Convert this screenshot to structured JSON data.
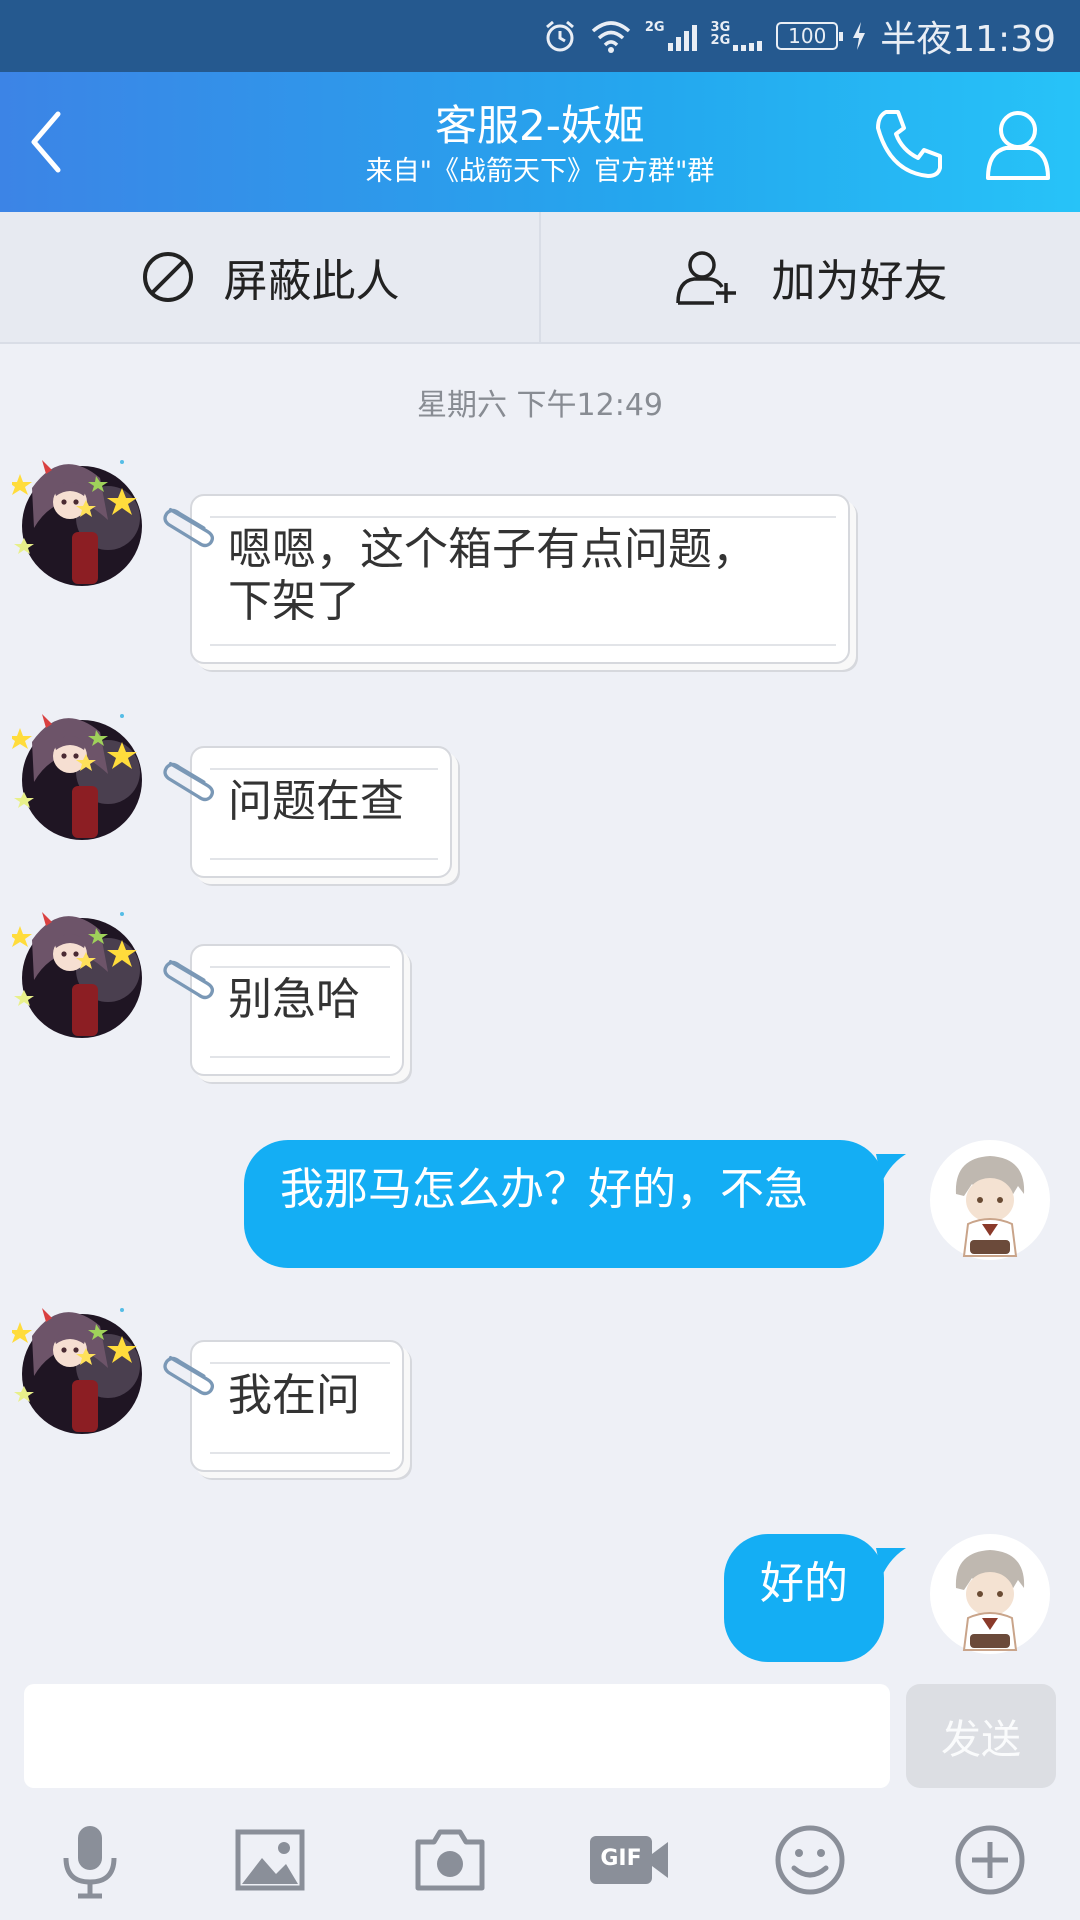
{
  "status_bar": {
    "net1": "2G",
    "net2_top": "3G",
    "net2_bottom": "2G",
    "battery": "100",
    "time": "半夜11:39",
    "icons": [
      "alarm-icon",
      "wifi-icon",
      "signal-icon",
      "battery-icon",
      "charging-icon"
    ]
  },
  "header": {
    "title": "客服2-妖姬",
    "subtitle": "来自\"《战箭天下》官方群\"群",
    "icons": [
      "back-icon",
      "phone-icon",
      "profile-icon"
    ]
  },
  "actions": {
    "block_label": "屏蔽此人",
    "add_friend_label": "加为好友"
  },
  "timestamp": "星期六 下午12:49",
  "messages": [
    {
      "side": "left",
      "text": "嗯嗯，这个箱子有点问题，\n下架了"
    },
    {
      "side": "left",
      "text": "问题在查"
    },
    {
      "side": "left",
      "text": "别急哈"
    },
    {
      "side": "right",
      "text": "我那马怎么办？好的，不急"
    },
    {
      "side": "left",
      "text": "我在问"
    },
    {
      "side": "right",
      "text": "好的"
    }
  ],
  "composer": {
    "input_value": "",
    "send_label": "发送"
  },
  "toolbar_icons": [
    "microphone-icon",
    "image-icon",
    "camera-icon",
    "gif-icon",
    "emoji-icon",
    "plus-icon"
  ],
  "toolbar_gif_label": "GIF",
  "colors": {
    "header_start": "#3c84e6",
    "header_end": "#27c3f8",
    "my_bubble": "#14aef4",
    "background": "#eef0f6"
  }
}
